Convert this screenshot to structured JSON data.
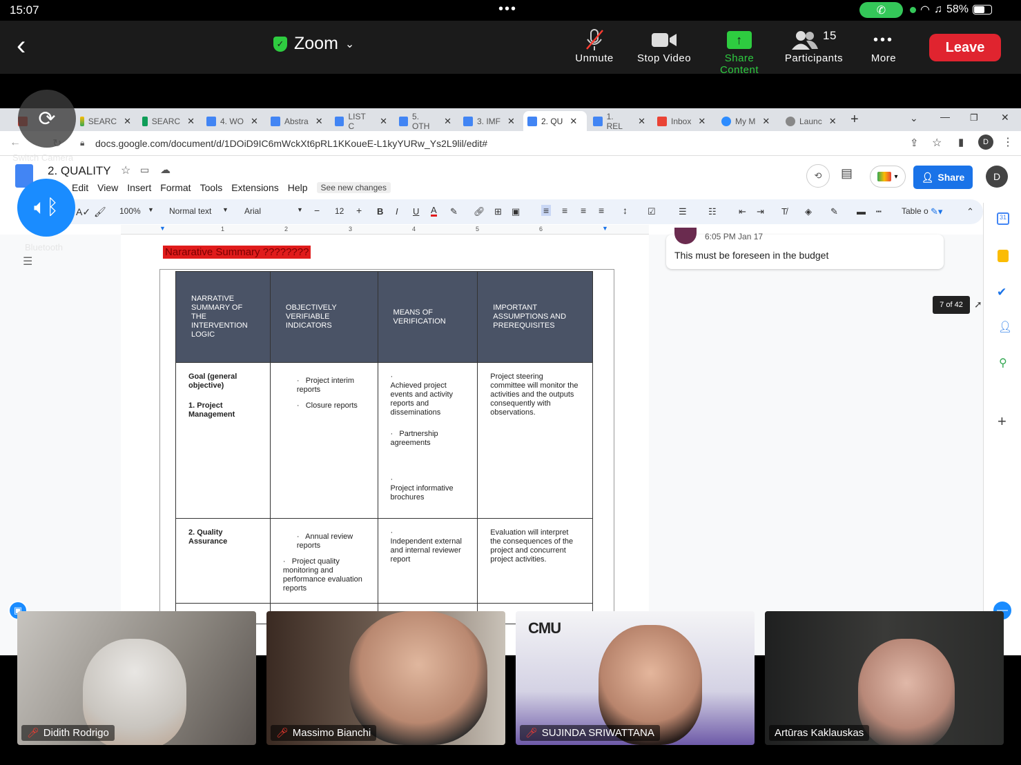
{
  "status": {
    "time": "15:07",
    "battery": "58%"
  },
  "zoom": {
    "title": "Zoom",
    "buttons": [
      {
        "label": "Unmute"
      },
      {
        "label": "Stop Video"
      },
      {
        "label": "Share Content"
      },
      {
        "label": "Participants",
        "count": "15"
      },
      {
        "label": "More"
      }
    ],
    "leave": "Leave"
  },
  "overlay": {
    "switch_camera": "Switch Camera",
    "bluetooth": "Bluetooth"
  },
  "browser": {
    "tabs": [
      "SEARC",
      "SEARC",
      "4. WO",
      "Abstra",
      "LIST C",
      "5. OTH",
      "3. IMF",
      "2. QU",
      "1. REL",
      "Inbox",
      "My M",
      "Launc"
    ],
    "url": "docs.google.com/document/d/1DOiD9IC6mWckXt6pRL1KKoueE-L1kyYURw_Ys2L9lil/edit#"
  },
  "doc": {
    "title": "2. QUALITY",
    "menu": [
      "Edit",
      "View",
      "Insert",
      "Format",
      "Tools",
      "Extensions",
      "Help"
    ],
    "see_new": "See new changes",
    "share": "Share",
    "avatar": "D",
    "toolbar": {
      "zoom": "100%",
      "style": "Normal text",
      "font": "Arial",
      "size": "12",
      "table": "Table o"
    },
    "ruler": [
      "1",
      "2",
      "3",
      "4",
      "5",
      "6"
    ],
    "heading": "Nararative Summary ????????",
    "table": {
      "headers": [
        "NARRATIVE SUMMARY OF THE INTERVENTION LOGIC",
        "OBJECTIVELY VERIFIABLE INDICATORS",
        "MEANS OF VERIFICATION",
        "IMPORTANT ASSUMPTIONS AND PREREQUISITES"
      ],
      "row1": {
        "c1a": "Goal (general objective)",
        "c1b": "1. Project Management",
        "c2a": "Project interim reports",
        "c2b": "Closure reports",
        "c3a": "Achieved project events and activity reports and disseminations",
        "c3b": "Partnership agreements",
        "c3c": "Project informative brochures",
        "c4": "Project steering committee will monitor the activities and the outputs consequently with observations."
      },
      "row2": {
        "c1": "2. Quality Assurance",
        "c2a": "Annual review reports",
        "c2b": "Project quality monitoring and performance evaluation reports",
        "c3": "Independent external and internal reviewer report",
        "c4": "Evaluation will interpret the consequences of the project and concurrent project activities."
      }
    },
    "comment": {
      "time": "6:05 PM Jan 17",
      "text": "This must be foreseen in the budget"
    },
    "tooltip": "7 of 42"
  },
  "participants": [
    {
      "name": "Didith Rodrigo"
    },
    {
      "name": "Massimo Bianchi"
    },
    {
      "name": "SUJINDA SRIWATTANA"
    },
    {
      "name": "Artūras Kaklauskas"
    }
  ],
  "cmu_logo": "CMU"
}
